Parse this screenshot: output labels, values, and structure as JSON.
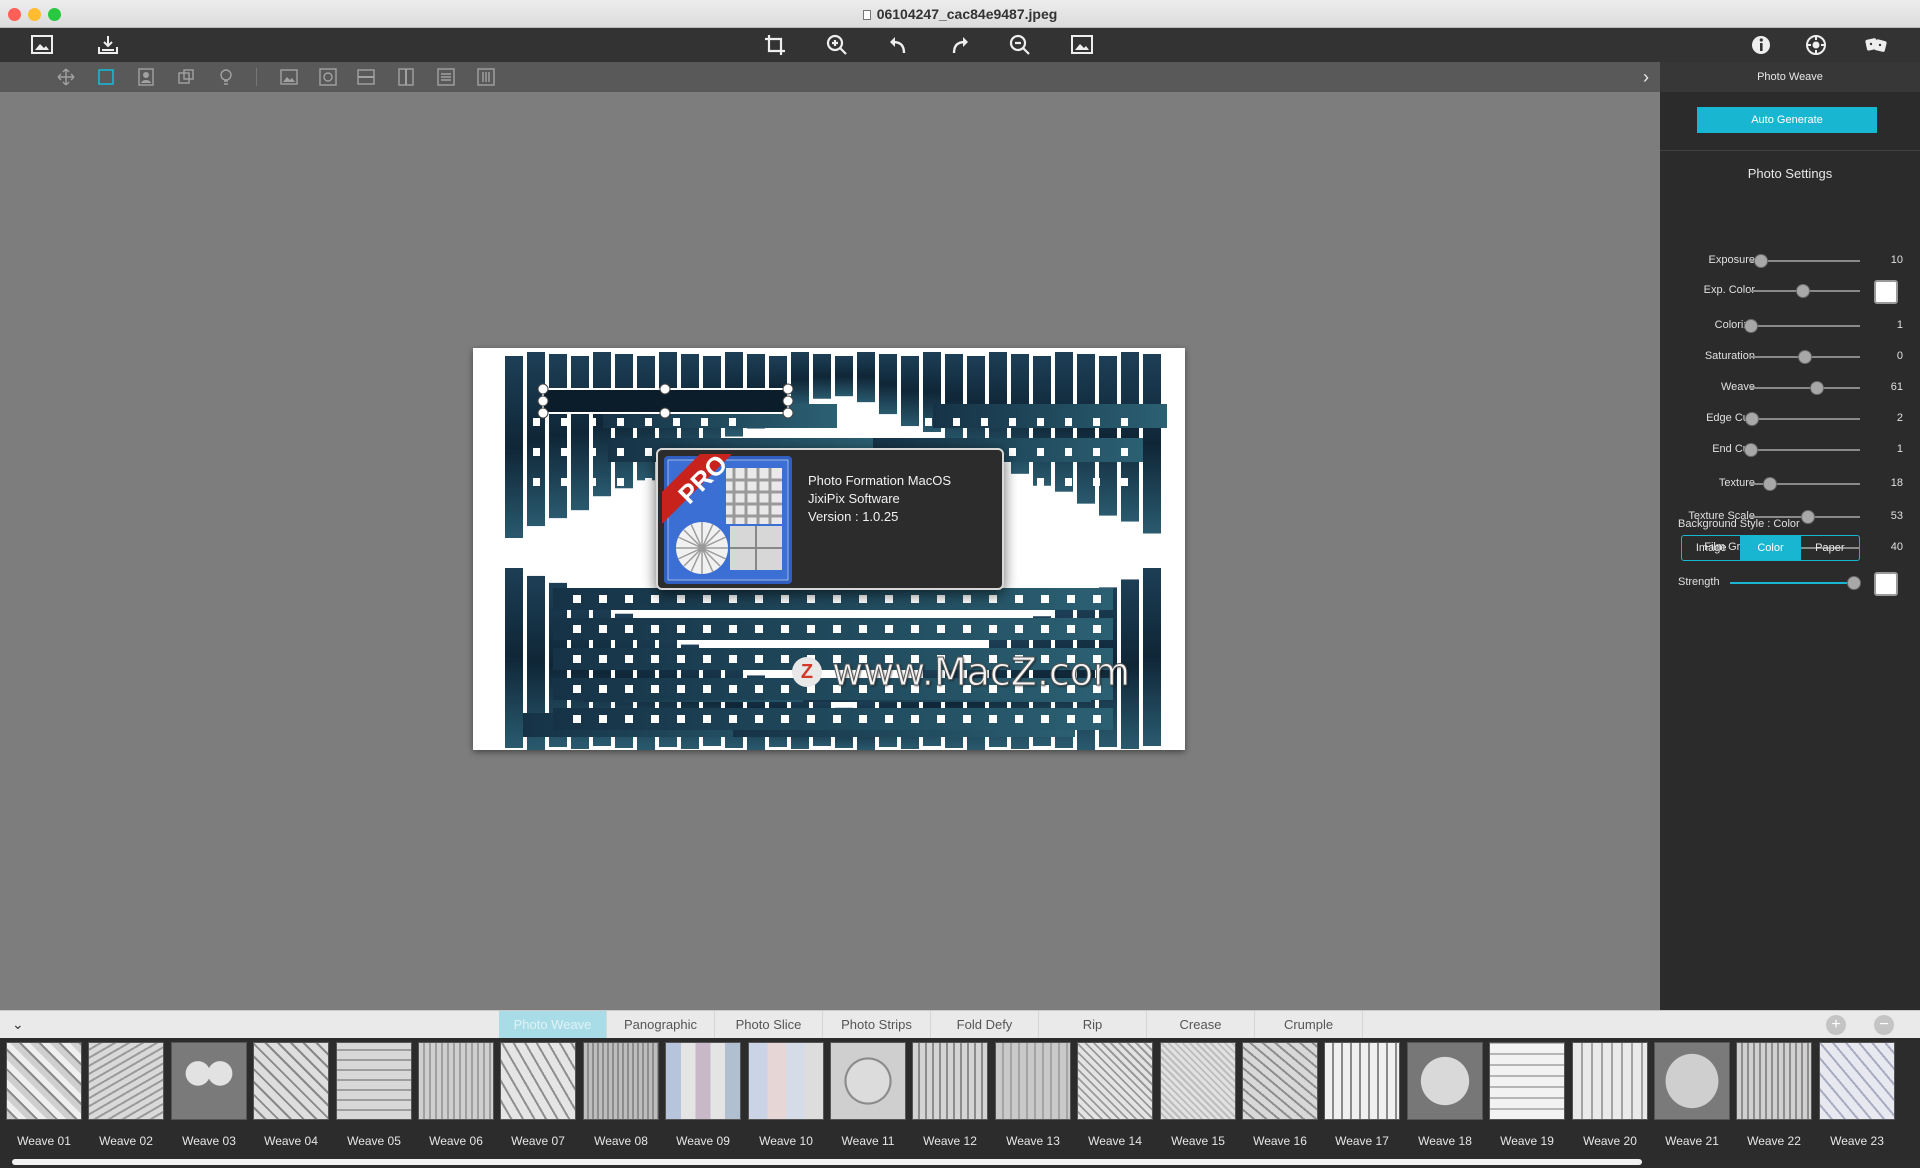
{
  "window": {
    "title": "06104247_cac84e9487.jpeg",
    "traffic_colors": {
      "close": "#ff5f57",
      "minimize": "#febc2e",
      "zoom": "#28c840"
    }
  },
  "toolbar": {
    "left": [
      "open-image-icon",
      "save-image-icon"
    ],
    "center": [
      "crop-icon",
      "zoom-in-icon",
      "rotate-left-icon",
      "rotate-right-icon",
      "zoom-out-icon",
      "fit-image-icon"
    ],
    "right": [
      "info-icon",
      "settings-icon",
      "dice-icon"
    ]
  },
  "about": {
    "badge": "PRO",
    "line1": "Photo Formation MacOS",
    "line2": "JixiPix Software",
    "line3": "Version : 1.0.25"
  },
  "watermark": {
    "badge": "Z",
    "text": "www.MacZ.com"
  },
  "panel": {
    "header": "Photo Weave",
    "auto_generate": "Auto Generate",
    "settings_title": "Photo Settings",
    "sliders": [
      {
        "label": "Exposure",
        "value": "10",
        "pos": 0.1
      },
      {
        "label": "Exp. Color",
        "value": "",
        "pos": 0.48,
        "swatch": "#ffffff"
      },
      {
        "label": "Colorize",
        "value": "1",
        "pos": 0.01
      },
      {
        "label": "Saturation",
        "value": "0",
        "pos": 0.5
      },
      {
        "label": "Weave",
        "value": "61",
        "pos": 0.61
      },
      {
        "label": "Edge Curl",
        "value": "2",
        "pos": 0.02
      },
      {
        "label": "End Curl",
        "value": "1",
        "pos": 0.01
      },
      {
        "label": "Texture",
        "value": "18",
        "pos": 0.18
      },
      {
        "label": "Texture Scale",
        "value": "53",
        "pos": 0.53
      },
      {
        "label": "Film Grain",
        "value": "40",
        "pos": 0.4
      }
    ],
    "background_style_label": "Background Style : Color",
    "background_options": [
      "Image",
      "Color",
      "Paper"
    ],
    "background_selected": "Color",
    "strength_label": "Strength",
    "strength_pos": 1.0,
    "strength_swatch": "#ffffff",
    "accent": "#19b6d2"
  },
  "bottom_tabs": [
    "Photo Weave",
    "Panographic",
    "Photo Slice",
    "Photo Strips",
    "Fold Defy",
    "Rip",
    "Crease",
    "Crumple"
  ],
  "bottom_tab_selected": "Photo Weave",
  "presets": [
    "Weave 01",
    "Weave 02",
    "Weave 03",
    "Weave 04",
    "Weave 05",
    "Weave 06",
    "Weave 07",
    "Weave 08",
    "Weave 09",
    "Weave 10",
    "Weave 11",
    "Weave 12",
    "Weave 13",
    "Weave 14",
    "Weave 15",
    "Weave 16",
    "Weave 17",
    "Weave 18",
    "Weave 19",
    "Weave 20",
    "Weave 21",
    "Weave 22",
    "Weave 23"
  ],
  "add_preset_glyph": "+",
  "remove_preset_glyph": "−",
  "collapse_glyph": "⌄",
  "panel_toggle_glyph": "›"
}
